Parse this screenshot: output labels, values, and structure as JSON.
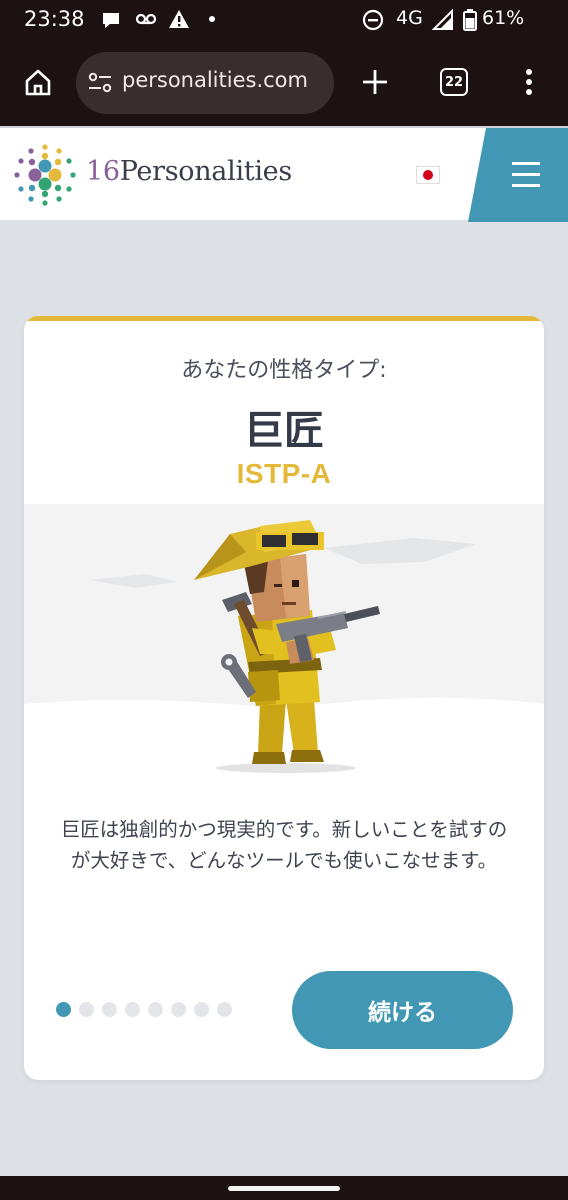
{
  "status_bar": {
    "time": "23:38",
    "network": "4G",
    "battery": "61%",
    "icons": [
      "chat-bubble-icon",
      "voicemail-icon",
      "warning-icon",
      "dot-icon",
      "do-not-disturb-icon",
      "signal-icon",
      "battery-icon"
    ]
  },
  "browser": {
    "url": "personalities.com",
    "tab_count": "22",
    "icons": [
      "home-icon",
      "site-settings-icon",
      "new-tab-icon",
      "more-menu-icon"
    ]
  },
  "site": {
    "logo_number": "16",
    "logo_word": "Personalities",
    "language_flag": "japan-flag-icon"
  },
  "card": {
    "heading": "あなたの性格タイプ:",
    "type_name": "巨匠",
    "type_code": "ISTP-A",
    "description": "巨匠は独創的かつ現実的です。新しいことを試すのが大好きで、どんなツールでも使いこなせます。",
    "pagination": {
      "total": 8,
      "active": 1
    },
    "continue_label": "続ける"
  },
  "colors": {
    "accent_blue": "#4298b4",
    "accent_yellow": "#e4b93a",
    "logo_purple": "#88619a"
  }
}
